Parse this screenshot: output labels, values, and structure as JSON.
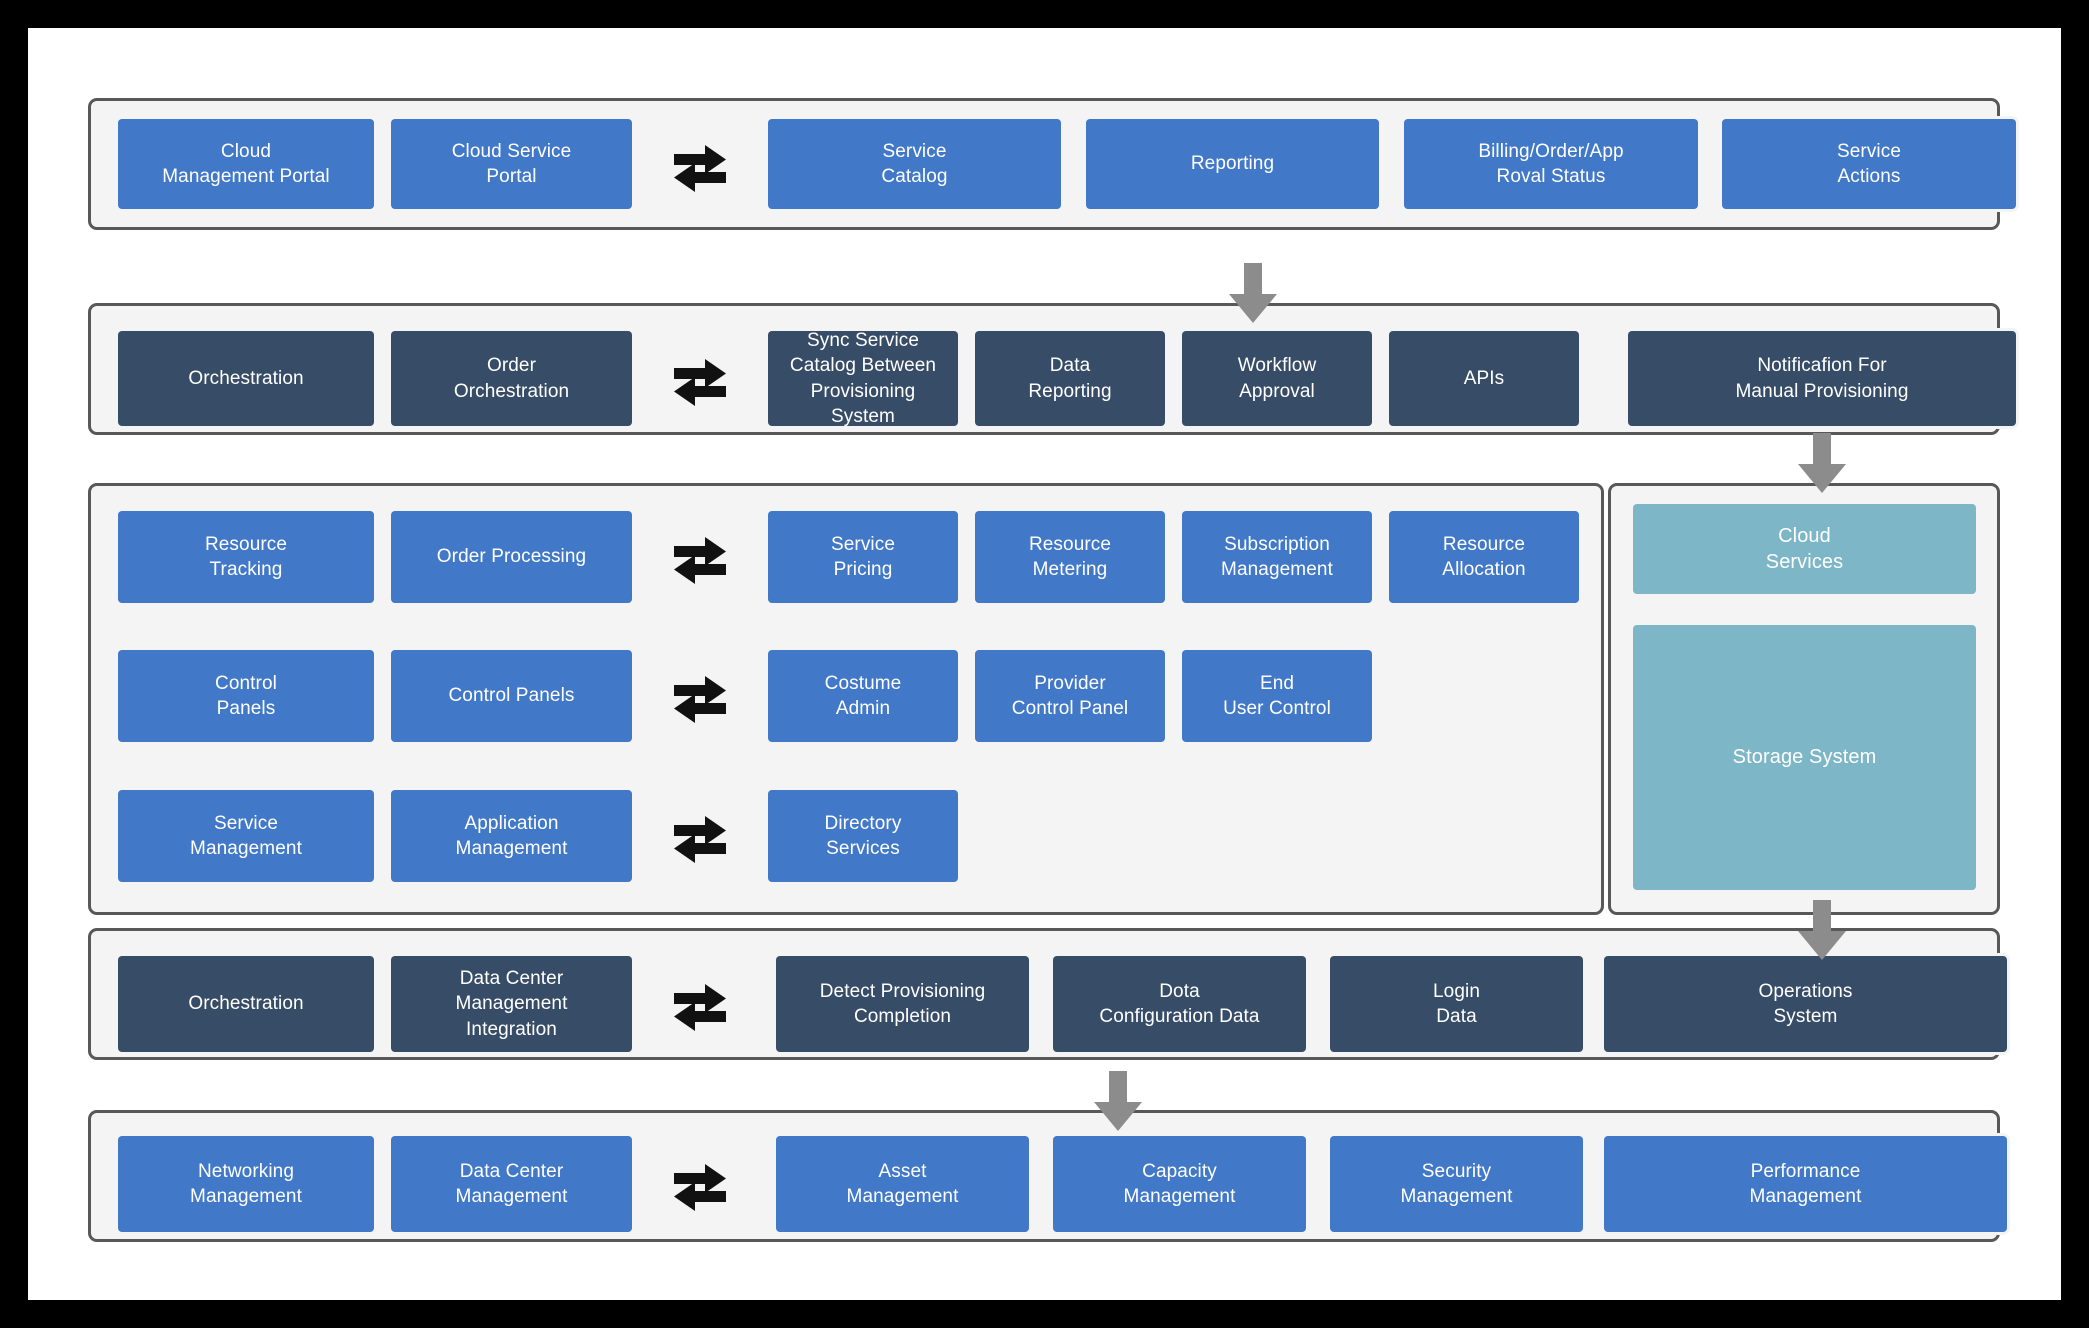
{
  "diagram": {
    "title": "Cloud Management Layered Architecture",
    "colors": {
      "blue": "#4178c8",
      "navy": "#374c66",
      "teal": "#7db6c6",
      "panel_fill": "#f4f4f4",
      "panel_border": "#585858",
      "connector": "#8c8c8c",
      "arrow": "#111111",
      "canvas": "#ffffff",
      "outer": "#000000"
    },
    "icons": {
      "bidirectional": "bidirectional-exchange-arrow",
      "downflow": "down-flow-arrow"
    }
  },
  "rows": [
    {
      "id": "portal-layer",
      "left": [
        {
          "label": "Cloud\nManagement Portal",
          "style": "blue"
        },
        {
          "label": "Cloud Service\nPortal",
          "style": "blue"
        }
      ],
      "right": [
        {
          "label": "Service\nCatalog",
          "style": "blue"
        },
        {
          "label": "Reporting",
          "style": "blue"
        },
        {
          "label": "Billing/Order/App\nRoval Status",
          "style": "blue"
        },
        {
          "label": "Service\nActions",
          "style": "blue"
        }
      ]
    },
    {
      "id": "orchestration-layer",
      "left": [
        {
          "label": "Orchestration",
          "style": "navy"
        },
        {
          "label": "Order\nOrchestration",
          "style": "navy"
        }
      ],
      "right": [
        {
          "label": "Sync Service\nCatalog Between\nProvisioning System",
          "style": "navy"
        },
        {
          "label": "Data\nReporting",
          "style": "navy"
        },
        {
          "label": "Workflow\nApproval",
          "style": "navy"
        },
        {
          "label": "APIs",
          "style": "navy"
        },
        {
          "label": "Notificafion For\nManual Provisioning",
          "style": "navy"
        }
      ]
    },
    {
      "id": "resource-layer-a",
      "left": [
        {
          "label": "Resource\nTracking",
          "style": "blue"
        },
        {
          "label": "Order Processing",
          "style": "blue"
        }
      ],
      "right": [
        {
          "label": "Service\nPricing",
          "style": "blue"
        },
        {
          "label": "Resource\nMetering",
          "style": "blue"
        },
        {
          "label": "Subscription\nManagement",
          "style": "blue"
        },
        {
          "label": "Resource\nAllocation",
          "style": "blue"
        }
      ]
    },
    {
      "id": "resource-layer-b",
      "left": [
        {
          "label": "Control\nPanels",
          "style": "blue"
        },
        {
          "label": "Control Panels",
          "style": "blue"
        }
      ],
      "right": [
        {
          "label": "Costume\nAdmin",
          "style": "blue"
        },
        {
          "label": "Provider\nControl Panel",
          "style": "blue"
        },
        {
          "label": "End\nUser Control",
          "style": "blue"
        }
      ]
    },
    {
      "id": "resource-layer-c",
      "left": [
        {
          "label": "Service\nManagement",
          "style": "blue"
        },
        {
          "label": "Application\nManagement",
          "style": "blue"
        }
      ],
      "right": [
        {
          "label": "Directory\nServices",
          "style": "blue"
        }
      ]
    },
    {
      "id": "datacenter-layer",
      "left": [
        {
          "label": "Orchestration",
          "style": "navy"
        },
        {
          "label": "Data Center\nManagement\nIntegration",
          "style": "navy"
        }
      ],
      "right": [
        {
          "label": "Detect Provisioning\nCompletion",
          "style": "navy"
        },
        {
          "label": "Dota\nConfiguration Data",
          "style": "navy"
        },
        {
          "label": "Login\nData",
          "style": "navy"
        },
        {
          "label": "Operations\nSystem",
          "style": "navy"
        }
      ]
    },
    {
      "id": "infrastructure-layer",
      "left": [
        {
          "label": "Networking\nManagement",
          "style": "blue"
        },
        {
          "label": "Data Center\nManagement",
          "style": "blue"
        }
      ],
      "right": [
        {
          "label": "Asset\nManagement",
          "style": "blue"
        },
        {
          "label": "Capacity\nManagement",
          "style": "blue"
        },
        {
          "label": "Security\nManagement",
          "style": "blue"
        },
        {
          "label": "Performance\nManagement",
          "style": "blue"
        }
      ]
    }
  ],
  "side_panel": {
    "id": "cloud-infrastructure-panel",
    "items": [
      {
        "label": "Cloud\nServices",
        "style": "teal"
      },
      {
        "label": "Storage System",
        "style": "teal"
      }
    ]
  }
}
